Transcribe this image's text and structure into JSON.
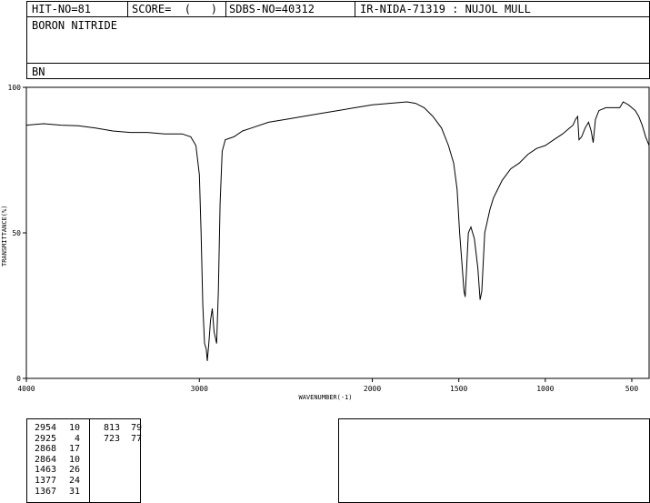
{
  "header": {
    "hit_no": "HIT-NO=81",
    "score": "SCORE=  (   )",
    "sdbs_no": "SDBS-NO=40312",
    "ir_code": "IR-NIDA-71319 : NUJOL MULL"
  },
  "compound": {
    "name": "BORON NITRIDE",
    "formula": "BN"
  },
  "peak_table": {
    "col1": [
      {
        "wn": "2954",
        "t": "10"
      },
      {
        "wn": "2925",
        "t": "4"
      },
      {
        "wn": "2868",
        "t": "17"
      },
      {
        "wn": "2864",
        "t": "10"
      },
      {
        "wn": "1463",
        "t": "26"
      },
      {
        "wn": "1377",
        "t": "24"
      },
      {
        "wn": "1367",
        "t": "31"
      }
    ],
    "col2": [
      {
        "wn": "813",
        "t": "79"
      },
      {
        "wn": "723",
        "t": "77"
      }
    ]
  },
  "chart_data": {
    "type": "line",
    "xlabel": "WAVENUMBER(-1)",
    "ylabel": "TRANSMITTANCE(%)",
    "xlim": [
      4000,
      400
    ],
    "ylim": [
      0,
      100
    ],
    "xticks": [
      4000,
      3000,
      2000,
      1500,
      1000,
      500
    ],
    "yticks": [
      0,
      50,
      100
    ],
    "grid": false,
    "series": [
      {
        "color": "#000000",
        "points": [
          [
            4000,
            87
          ],
          [
            3900,
            87.5
          ],
          [
            3800,
            87
          ],
          [
            3700,
            86.8
          ],
          [
            3600,
            86
          ],
          [
            3500,
            85
          ],
          [
            3400,
            84.5
          ],
          [
            3300,
            84.5
          ],
          [
            3200,
            84
          ],
          [
            3100,
            84
          ],
          [
            3050,
            83
          ],
          [
            3020,
            80
          ],
          [
            3000,
            70
          ],
          [
            2990,
            50
          ],
          [
            2980,
            25
          ],
          [
            2970,
            12
          ],
          [
            2960,
            10
          ],
          [
            2954,
            6
          ],
          [
            2945,
            12
          ],
          [
            2935,
            20
          ],
          [
            2925,
            24
          ],
          [
            2915,
            16
          ],
          [
            2900,
            12
          ],
          [
            2890,
            30
          ],
          [
            2880,
            60
          ],
          [
            2868,
            78
          ],
          [
            2850,
            82
          ],
          [
            2800,
            83
          ],
          [
            2750,
            85
          ],
          [
            2700,
            86
          ],
          [
            2600,
            88
          ],
          [
            2500,
            89
          ],
          [
            2400,
            90
          ],
          [
            2300,
            91
          ],
          [
            2200,
            92
          ],
          [
            2100,
            93
          ],
          [
            2000,
            94
          ],
          [
            1900,
            94.5
          ],
          [
            1800,
            95
          ],
          [
            1750,
            94.5
          ],
          [
            1700,
            93
          ],
          [
            1650,
            90
          ],
          [
            1600,
            86
          ],
          [
            1560,
            80
          ],
          [
            1530,
            74
          ],
          [
            1510,
            65
          ],
          [
            1495,
            50
          ],
          [
            1480,
            38
          ],
          [
            1470,
            30
          ],
          [
            1463,
            28
          ],
          [
            1455,
            38
          ],
          [
            1445,
            50
          ],
          [
            1430,
            52
          ],
          [
            1410,
            48
          ],
          [
            1390,
            38
          ],
          [
            1377,
            27
          ],
          [
            1367,
            30
          ],
          [
            1350,
            50
          ],
          [
            1320,
            58
          ],
          [
            1300,
            62
          ],
          [
            1250,
            68
          ],
          [
            1200,
            72
          ],
          [
            1150,
            74
          ],
          [
            1100,
            77
          ],
          [
            1050,
            79
          ],
          [
            1000,
            80
          ],
          [
            950,
            82
          ],
          [
            900,
            84
          ],
          [
            860,
            86
          ],
          [
            840,
            87
          ],
          [
            825,
            89
          ],
          [
            813,
            90
          ],
          [
            805,
            82
          ],
          [
            790,
            83
          ],
          [
            770,
            86
          ],
          [
            750,
            88
          ],
          [
            735,
            85
          ],
          [
            723,
            81
          ],
          [
            710,
            89
          ],
          [
            690,
            92
          ],
          [
            650,
            93
          ],
          [
            600,
            93
          ],
          [
            570,
            93
          ],
          [
            550,
            95
          ],
          [
            520,
            94
          ],
          [
            500,
            93
          ],
          [
            480,
            92
          ],
          [
            460,
            90
          ],
          [
            440,
            87
          ],
          [
            420,
            83
          ],
          [
            400,
            80
          ]
        ]
      }
    ]
  }
}
